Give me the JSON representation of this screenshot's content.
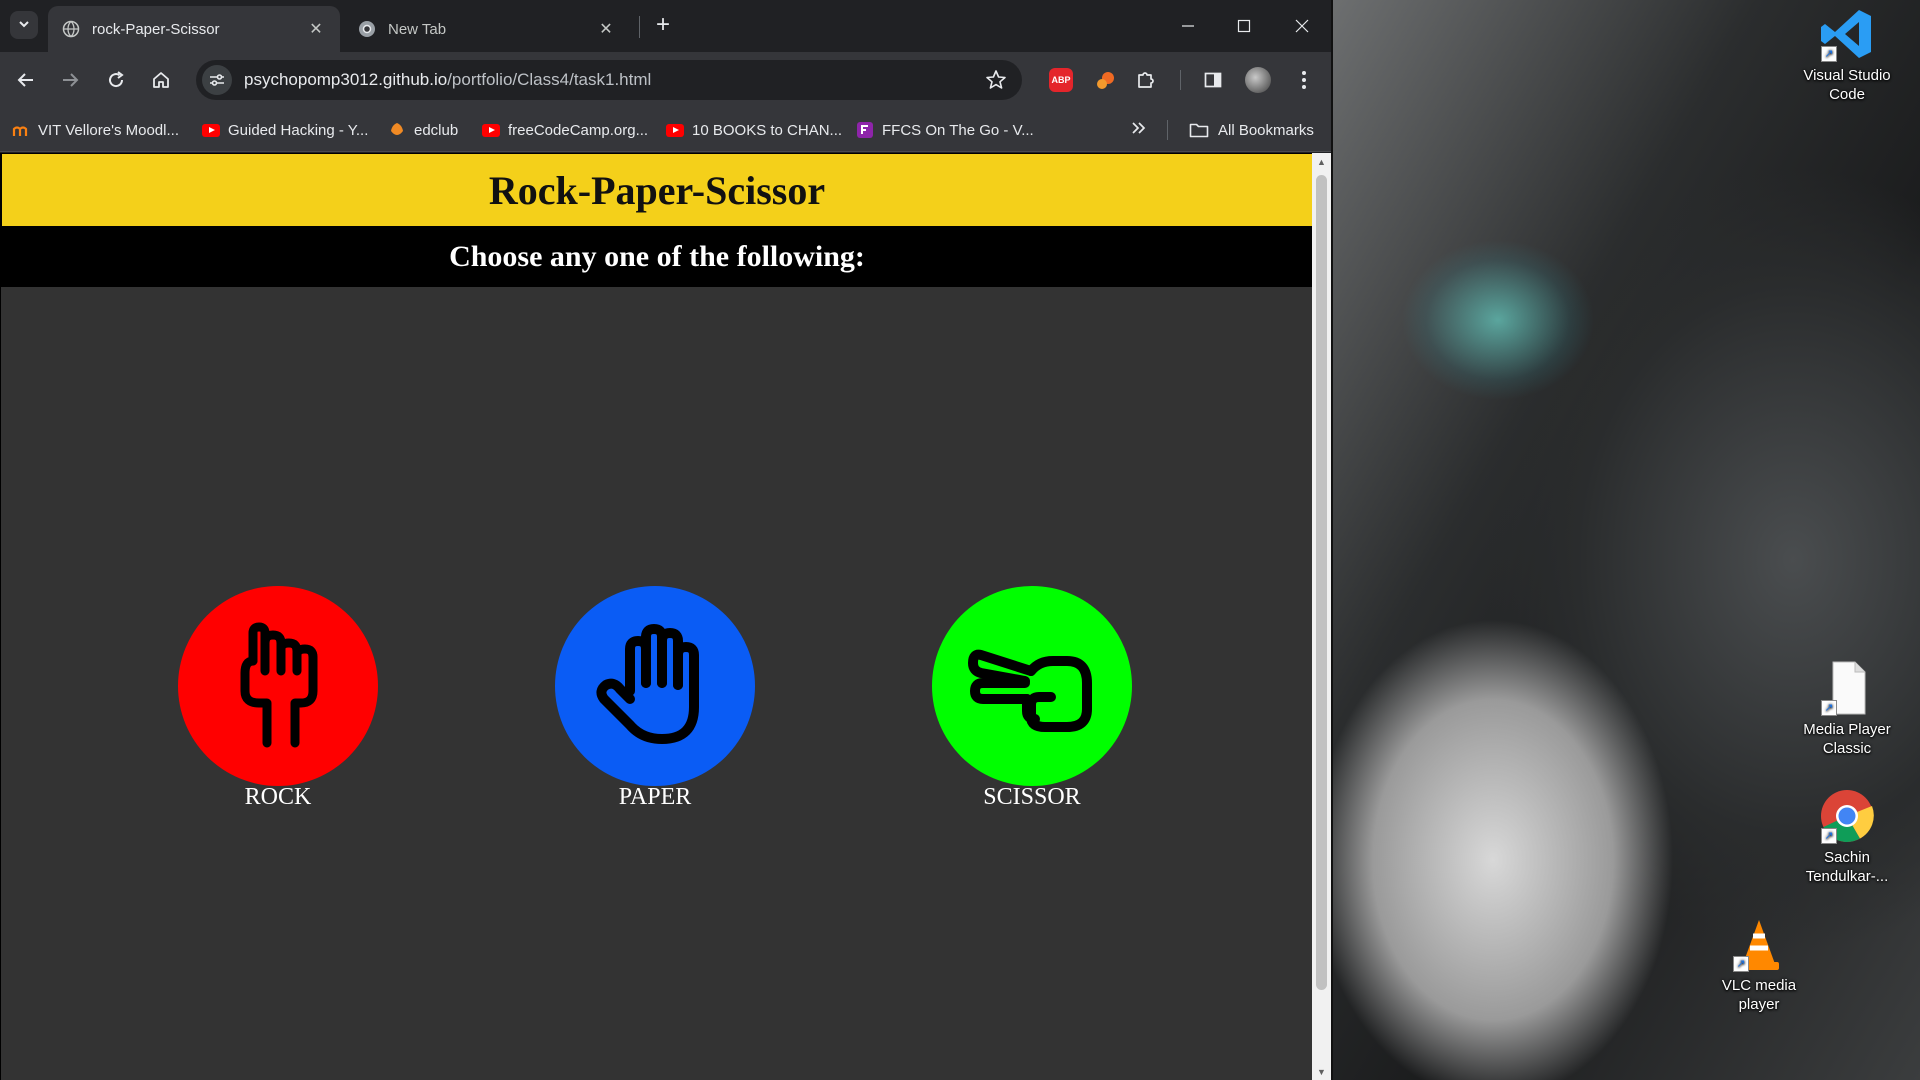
{
  "browser": {
    "tabs": [
      {
        "title": "rock-Paper-Scissor",
        "active": true
      },
      {
        "title": "New Tab",
        "active": false
      }
    ],
    "address_host": "psychopomp3012.github.io",
    "address_path": "/portfolio/Class4/task1.html",
    "extensions": [
      "adblock-plus-icon",
      "squirrel-extension-icon",
      "puzzle-extensions-icon"
    ],
    "adblock_label": "ABP",
    "bookmarks": [
      {
        "label": "VIT Vellore's Moodl...",
        "icon": "moodle-icon"
      },
      {
        "label": "Guided Hacking - Y...",
        "icon": "youtube-icon"
      },
      {
        "label": "edclub",
        "icon": "edclub-icon"
      },
      {
        "label": "freeCodeCamp.org...",
        "icon": "youtube-icon"
      },
      {
        "label": "10 BOOKS to CHAN...",
        "icon": "youtube-icon"
      },
      {
        "label": "FFCS On The Go - V...",
        "icon": "ffcs-icon"
      }
    ],
    "all_bookmarks_label": "All Bookmarks"
  },
  "page": {
    "title": "Rock-Paper-Scissor",
    "subtitle": "Choose any one of the following:",
    "choices": [
      {
        "label": "ROCK",
        "color": "#ff0000",
        "icon": "fist-icon"
      },
      {
        "label": "PAPER",
        "color": "#0a5cf5",
        "icon": "open-hand-icon"
      },
      {
        "label": "SCISSOR",
        "color": "#00ff00",
        "icon": "scissor-hand-icon"
      }
    ],
    "header_color": "#f4d01a",
    "background_color": "#333333"
  },
  "desktop": {
    "icons": [
      {
        "label": "Visual Studio Code"
      },
      {
        "label": "Media Player Classic"
      },
      {
        "label": "Sachin Tendulkar-..."
      },
      {
        "label": "VLC media player"
      }
    ]
  }
}
